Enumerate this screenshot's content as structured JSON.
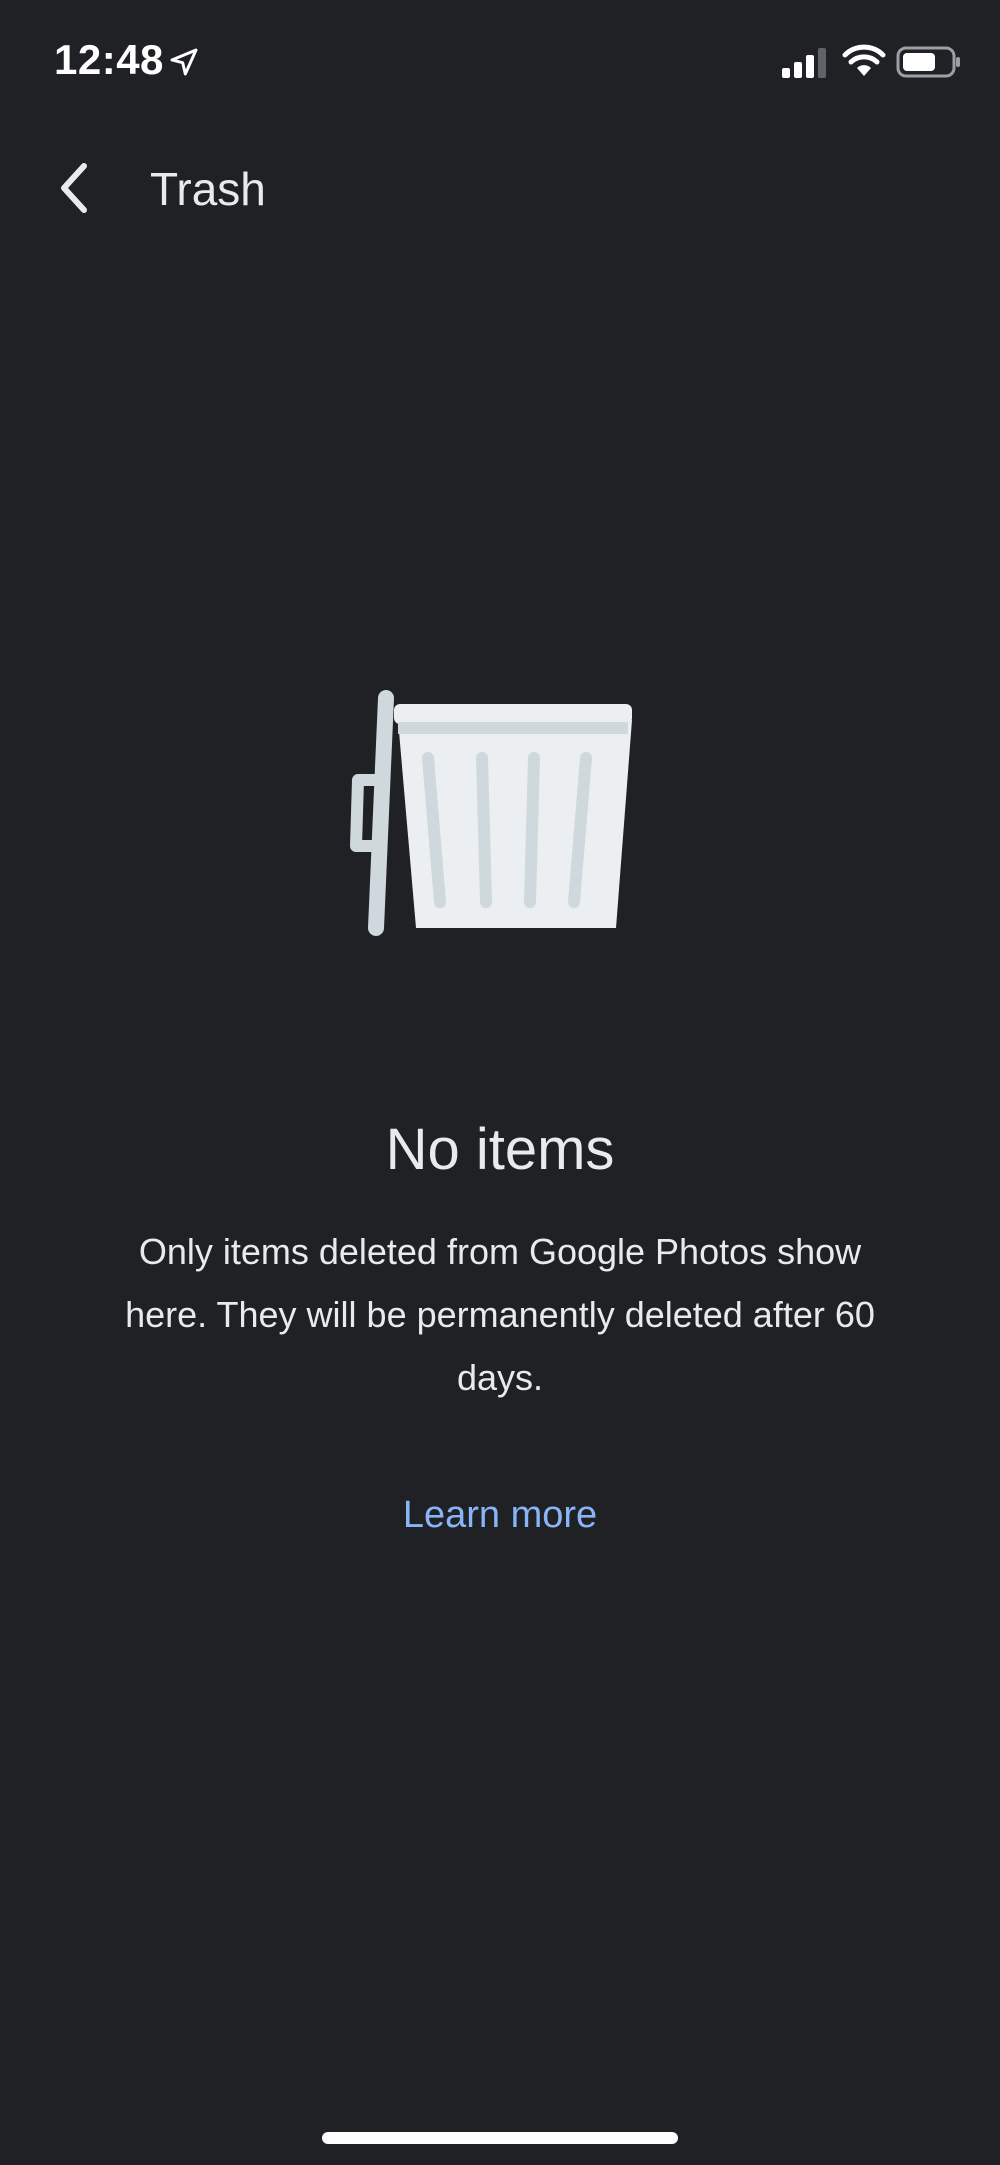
{
  "status_bar": {
    "time": "12:48",
    "icons": [
      "location-arrow-icon",
      "cellular-signal-icon",
      "wifi-icon",
      "battery-icon"
    ]
  },
  "app_bar": {
    "back_icon": "chevron-left-icon",
    "title": "Trash"
  },
  "empty_state": {
    "illustration": "trash-bin-icon",
    "title": "No items",
    "description": "Only items deleted from Google Photos show here. They will be permanently deleted after 60 days.",
    "link_label": "Learn more"
  },
  "colors": {
    "background": "#202124",
    "text": "#e8eaed",
    "link": "#8ab4f8",
    "bin_body": "#eceff1",
    "bin_accent": "#cfd8dc"
  }
}
